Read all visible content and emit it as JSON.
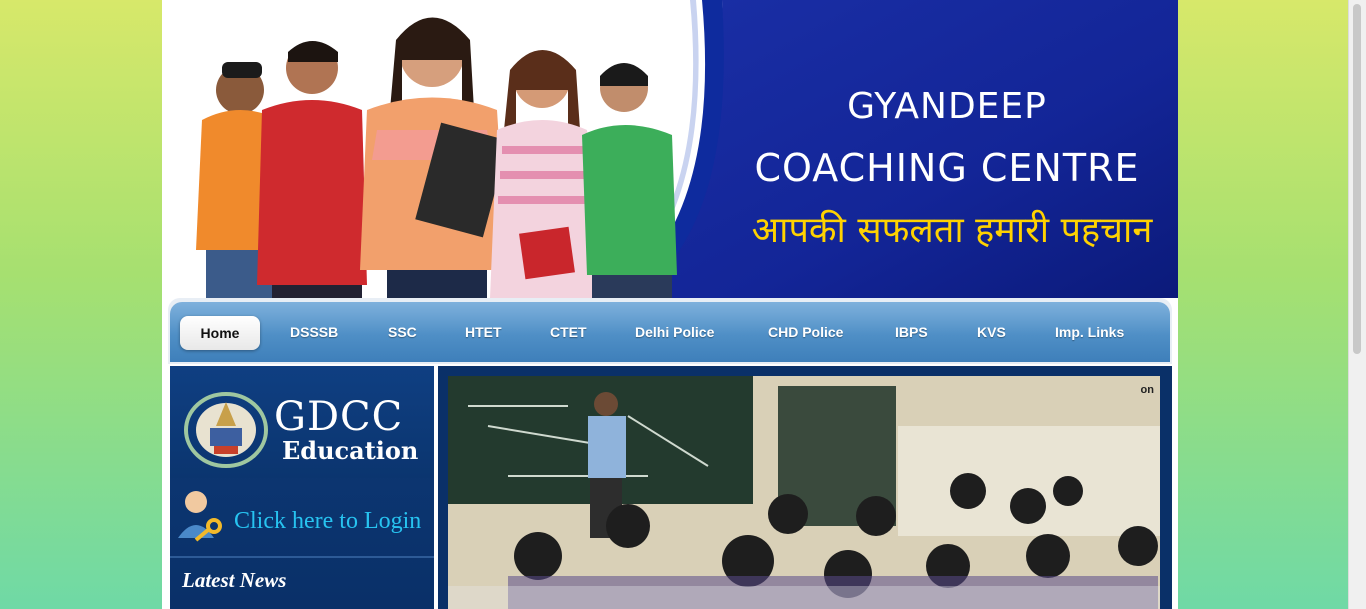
{
  "header": {
    "title_line1": "GYANDEEP",
    "title_line2": "COACHING CENTRE",
    "tagline": "आपकी सफलता हमारी पहचान"
  },
  "nav": {
    "items": [
      {
        "label": "Home",
        "active": true
      },
      {
        "label": "DSSSB"
      },
      {
        "label": "SSC"
      },
      {
        "label": "HTET"
      },
      {
        "label": "CTET"
      },
      {
        "label": "Delhi Police"
      },
      {
        "label": "CHD Police"
      },
      {
        "label": "IBPS"
      },
      {
        "label": "KVS"
      },
      {
        "label": "Imp. Links"
      }
    ]
  },
  "sidebar": {
    "logo_text": "GDCC",
    "logo_subtext": "Education",
    "login_label": "Click here to Login",
    "news_title": "Latest News"
  },
  "main": {
    "photo_watermark": "on"
  },
  "colors": {
    "brand_blue": "#0a3068",
    "nav_blue": "#4f8fc6",
    "tagline_yellow": "#ffd200",
    "login_cyan": "#27c3f0"
  }
}
